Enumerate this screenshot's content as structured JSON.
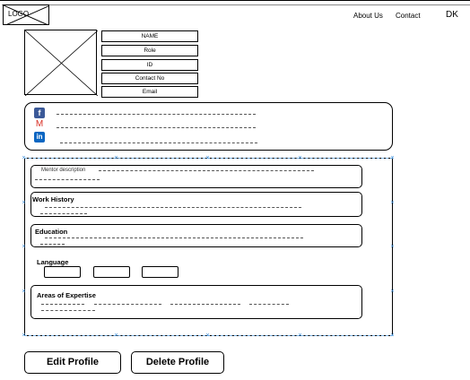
{
  "header": {
    "logo_text": "LOGO",
    "nav": [
      {
        "label": "About Us"
      },
      {
        "label": "Contact"
      }
    ],
    "user_initials": "DK"
  },
  "profile": {
    "photo_icon": "image-placeholder-icon",
    "fields": [
      "NAME",
      "Role",
      "ID",
      "Contact No",
      "Email"
    ]
  },
  "social": {
    "items": [
      {
        "icon": "facebook-icon",
        "glyph": "f",
        "color": "#3b5998"
      },
      {
        "icon": "gmail-icon",
        "glyph": "M",
        "color": "#d93025"
      },
      {
        "icon": "linkedin-icon",
        "glyph": "in",
        "color": "#0a66c2"
      }
    ]
  },
  "sections": {
    "mentor_description": "Mentor description",
    "work_history": "Work History",
    "education": "Education",
    "language": "Language",
    "areas_of_expertise": "Areas of Expertise"
  },
  "actions": {
    "edit": "Edit Profile",
    "delete": "Delete Profile"
  },
  "colors": {
    "selection_handle": "#3a8edb"
  }
}
